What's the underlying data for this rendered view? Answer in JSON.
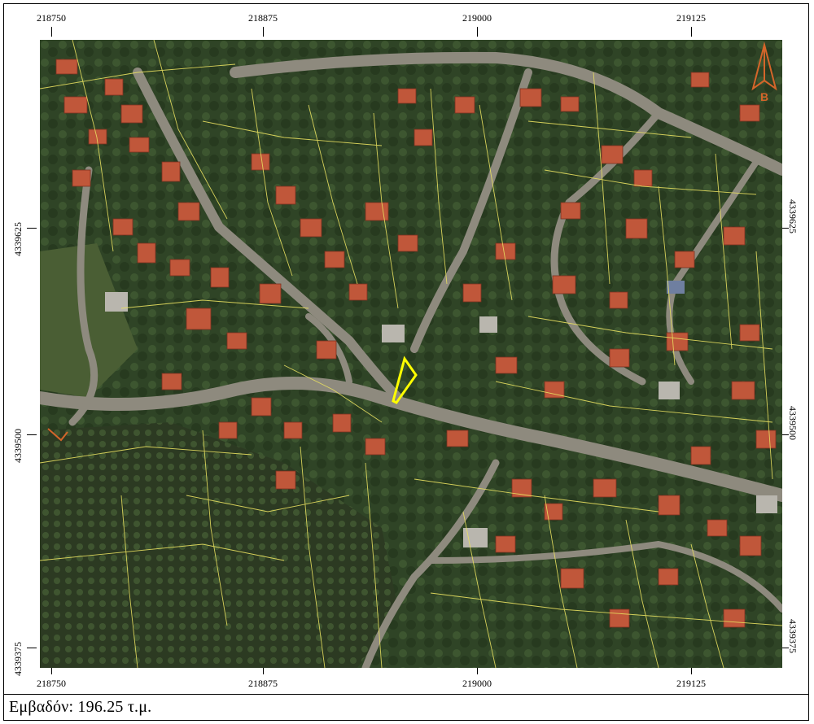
{
  "map": {
    "x_ticks": [
      "218750",
      "218875",
      "219000",
      "219125"
    ],
    "y_ticks": [
      "4339625",
      "4339500",
      "4339375"
    ],
    "north_arrow_label": "B",
    "colors": {
      "parcel_lines": "#e8e060",
      "selected_parcel": "#ffff00",
      "roads": "#8e8a7e",
      "vegetation": "#2f4426",
      "roofs": "#c0573a"
    }
  },
  "footer": {
    "area_text": "Εμβαδόν: 196.25 τ.μ."
  }
}
